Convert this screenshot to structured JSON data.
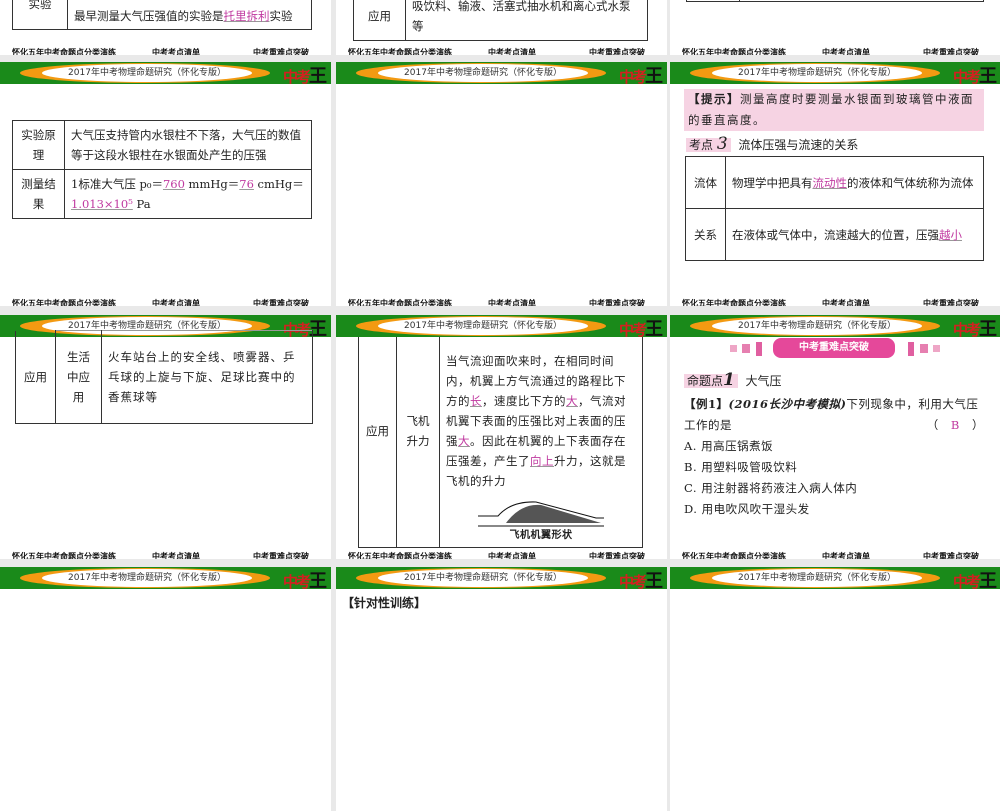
{
  "header": {
    "title": "2017年中考物理命题研究（怀化专版）",
    "logo": "中考王"
  },
  "footer": {
    "left": "怀化五年中考命题点分类演练",
    "mid": "中考考点清单",
    "right": "中考重难点突破"
  },
  "slide_r0c0": {
    "label": "实验",
    "text_pre": "最早测量大气压强值的实验是",
    "answer": "托里拆利",
    "text_post": "实验"
  },
  "slide_r0c1": {
    "label": "应用",
    "text": "吸饮料、输液、活塞式抽水机和离心式水泵等"
  },
  "slide_r1c0": {
    "rows": [
      {
        "label": "实验原理",
        "text": "大气压支持管内水银柱不下落，大气压的数值等于这段水银柱在水银面处产生的压强"
      },
      {
        "label": "测量结果",
        "pre": "1标准大气压 p₀＝",
        "a1": "760",
        "mid1": " mmHg＝",
        "a2": "76",
        "mid2": " cmHg＝",
        "a3": "1.013×10⁵",
        "post": " Pa"
      }
    ]
  },
  "slide_r1c2": {
    "tip_label": "【提示】",
    "tip": "测量高度时要测量水银面到玻璃管中液面的垂直高度。",
    "point_label": "考点",
    "point_num": "3",
    "point_title": "流体压强与流速的关系",
    "rows": [
      {
        "label": "流体",
        "pre": "物理学中把具有",
        "answer": "流动性",
        "post": "的液体和气体统称为流体"
      },
      {
        "label": "关系",
        "pre": "在液体或气体中，流速越大的位置，压强",
        "answer": "越小",
        "post": ""
      }
    ]
  },
  "slide_r2c0": {
    "label": "应用",
    "sub": "生活中应用",
    "text": "火车站台上的安全线、喷雾器、乒乓球的上旋与下旋、足球比赛中的香蕉球等"
  },
  "slide_r2c1": {
    "label": "应用",
    "sub": "飞机升力",
    "t1": "当气流迎面吹来时，在相同时间内，机翼上方气流通过的路程比下方的",
    "a1": "长",
    "t2": "，速度比下方的",
    "a2": "大",
    "t3": "，气流对机翼下表面的压强比对上表面的压强",
    "a3": "大",
    "t4": "。因此在机翼的上下表面存在压强差，产生了",
    "a4": "向上",
    "t5": "升力，这就是飞机的升力",
    "caption": "飞机机翼形状"
  },
  "slide_r2c2": {
    "banner": "中考重难点突破",
    "point_label": "命题点",
    "point_num": "1",
    "point_title": "大气压",
    "example": "【例1】",
    "source": "(2016长沙中考模拟)",
    "question": "下列现象中，利用大气压工作的是",
    "answer": "B",
    "options": [
      "A. 用高压锅煮饭",
      "B. 用塑料吸管吸饮料",
      "C. 用注射器将药液注入病人体内",
      "D. 用电吹风吹干湿头发"
    ]
  },
  "slide_r3c1": {
    "heading": "【针对性训练】"
  }
}
